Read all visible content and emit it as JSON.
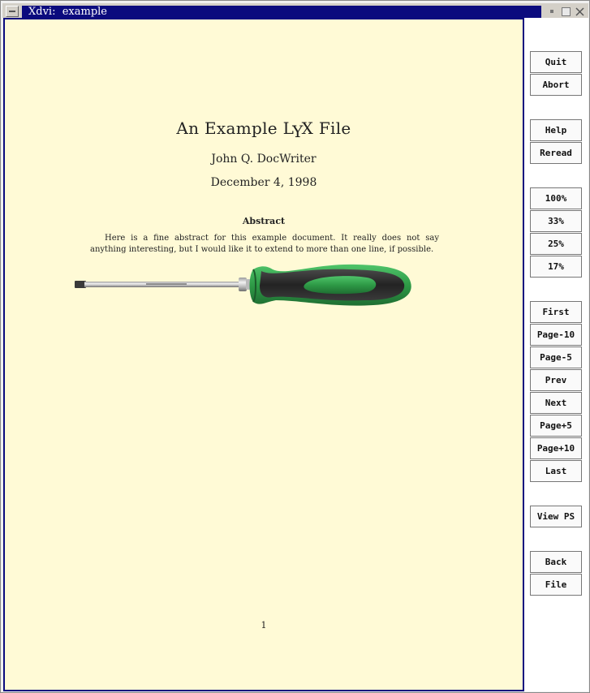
{
  "window": {
    "title": "Xdvi:  example"
  },
  "document": {
    "title": "An Example LyX File",
    "title_parts": [
      "An Example L",
      "Y",
      "X File"
    ],
    "author": "John Q. DocWriter",
    "date": "December 4, 1998",
    "abstract_heading": "Abstract",
    "abstract_text": "Here is a fine abstract for this example document. It really does not say anything interesting, but I would like it to extend to more than one line, if possible.",
    "page_number": "1"
  },
  "buttons": {
    "quit": "Quit",
    "abort": "Abort",
    "help": "Help",
    "reread": "Reread",
    "zoom100": "100%",
    "zoom33": "33%",
    "zoom25": "25%",
    "zoom17": "17%",
    "first": "First",
    "page_minus10": "Page-10",
    "page_minus5": "Page-5",
    "prev": "Prev",
    "next": "Next",
    "page_plus5": "Page+5",
    "page_plus10": "Page+10",
    "last": "Last",
    "view_ps": "View PS",
    "back": "Back",
    "file": "File"
  },
  "colors": {
    "page_background": "#fffad6",
    "title_bar": "#0b0b7e",
    "frame_border": "#0b0b7e",
    "screwdriver_handle_green": "#2e9a46",
    "screwdriver_handle_dark": "#2b2b2b"
  }
}
